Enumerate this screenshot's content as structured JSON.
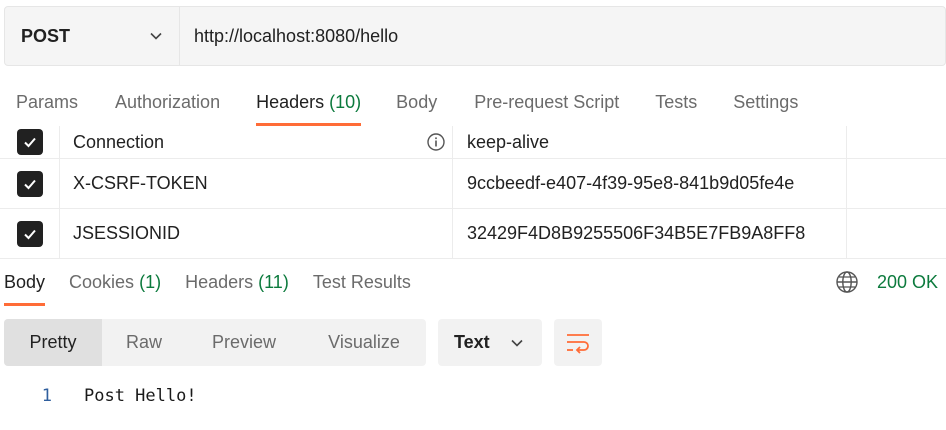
{
  "request": {
    "method": "POST",
    "url": "http://localhost:8080/hello"
  },
  "request_tabs": [
    {
      "label": "Params",
      "count": ""
    },
    {
      "label": "Authorization",
      "count": ""
    },
    {
      "label": "Headers",
      "count": "(10)"
    },
    {
      "label": "Body",
      "count": ""
    },
    {
      "label": "Pre-request Script",
      "count": ""
    },
    {
      "label": "Tests",
      "count": ""
    },
    {
      "label": "Settings",
      "count": ""
    }
  ],
  "headers": [
    {
      "key": "Connection",
      "value": "keep-alive",
      "checked": true
    },
    {
      "key": "X-CSRF-TOKEN",
      "value": "9ccbeedf-e407-4f39-95e8-841b9d05fe4e",
      "checked": true
    },
    {
      "key": "JSESSIONID",
      "value": "32429F4D8B9255506F34B5E7FB9A8FF8",
      "checked": true
    }
  ],
  "response_tabs": [
    {
      "label": "Body",
      "count": ""
    },
    {
      "label": "Cookies",
      "count": "(1)"
    },
    {
      "label": "Headers",
      "count": "(11)"
    },
    {
      "label": "Test Results",
      "count": ""
    }
  ],
  "response": {
    "status": "200 OK",
    "views": [
      "Pretty",
      "Raw",
      "Preview",
      "Visualize"
    ],
    "format": "Text",
    "lines": [
      {
        "no": "1",
        "text": "Post Hello!"
      }
    ]
  },
  "colors": {
    "accent": "#ff6c37",
    "status_green": "#0c7a3d"
  }
}
